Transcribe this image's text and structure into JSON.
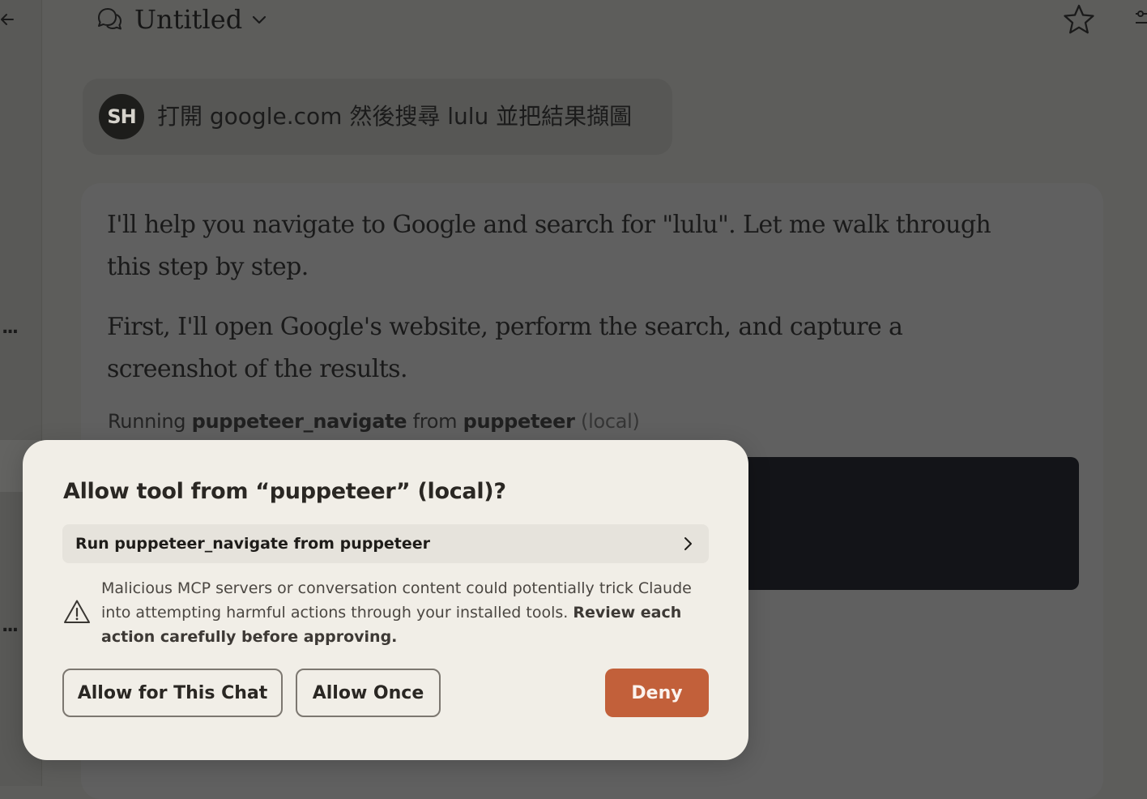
{
  "window": {
    "title": "Untitled"
  },
  "sidebar": {
    "ellipsis_1": "...",
    "ellipsis_2": "..."
  },
  "user_message": {
    "avatar_initials": "SH",
    "text": "打開 google.com 然後搜尋 lulu 並把結果擷圖"
  },
  "assistant": {
    "paragraph_1": "I'll help you navigate to Google and search for \"lulu\". Let me walk through this step by step.",
    "paragraph_2": "First, I'll open Google's website, perform the search, and capture a screenshot of the results.",
    "running": {
      "prefix": "Running",
      "tool": "puppeteer_navigate",
      "from": "from",
      "server": "puppeteer",
      "scope": "(local)"
    }
  },
  "dialog": {
    "title": "Allow tool from “puppeteer” (local)?",
    "tool_row_label": "Run puppeteer_navigate from puppeteer",
    "warning_text": "Malicious MCP servers or conversation content could potentially trick Claude into attempting harmful actions through your installed tools.",
    "warning_bold": "Review each action carefully before approving.",
    "buttons": {
      "allow_chat": "Allow for This Chat",
      "allow_once": "Allow Once",
      "deny": "Deny"
    },
    "colors": {
      "deny": "#c2603a",
      "background": "#f1eee7"
    }
  },
  "icons": [
    "back-arrow-icon",
    "chat-bubbles-icon",
    "chevron-down-icon",
    "star-icon",
    "settings-sliders-icon",
    "chevron-right-icon",
    "warning-triangle-icon"
  ]
}
